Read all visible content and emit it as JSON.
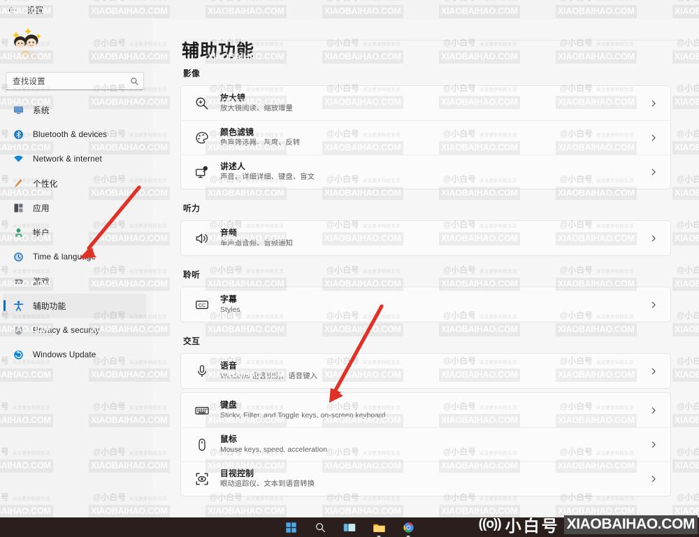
{
  "titlebar": {
    "back_icon": "back-arrow-icon",
    "title": "设置"
  },
  "sidebar": {
    "avatar": "user-avatar",
    "search": {
      "placeholder": "查找设置",
      "value": "查找设置",
      "icon": "search-icon"
    },
    "items": [
      {
        "label": "系统",
        "icon": "monitor-icon",
        "selected": false
      },
      {
        "label": "Bluetooth & devices",
        "icon": "bluetooth-icon",
        "selected": false
      },
      {
        "label": "Network & internet",
        "icon": "wifi-icon",
        "selected": false
      },
      {
        "label": "个性化",
        "icon": "brush-icon",
        "selected": false
      },
      {
        "label": "应用",
        "icon": "apps-icon",
        "selected": false
      },
      {
        "label": "帐户",
        "icon": "account-icon",
        "selected": false
      },
      {
        "label": "Time & language",
        "icon": "clock-icon",
        "selected": false
      },
      {
        "label": "游戏",
        "icon": "gamepad-icon",
        "selected": false
      },
      {
        "label": "辅助功能",
        "icon": "accessibility-icon",
        "selected": true
      },
      {
        "label": "Privacy & security",
        "icon": "shield-icon",
        "selected": false
      },
      {
        "label": "Windows Update",
        "icon": "update-icon",
        "selected": false
      }
    ]
  },
  "main": {
    "page_title": "辅助功能",
    "groups": [
      {
        "title": "影像",
        "cards": [
          {
            "rows": [
              {
                "title": "放大镜",
                "subtitle": "放大镜阅读、缩放增量",
                "icon": "magnifier-icon",
                "chevron": "chevron-right-icon"
              },
              {
                "title": "颜色滤镜",
                "subtitle": "色盲筛选器、灰度、反转",
                "icon": "color-palette-icon",
                "chevron": "chevron-right-icon"
              },
              {
                "title": "讲述人",
                "subtitle": "声音、详细详细、键盘、盲文",
                "icon": "narrator-icon",
                "chevron": "chevron-right-icon"
              }
            ]
          }
        ]
      },
      {
        "title": "听力",
        "cards": [
          {
            "rows": [
              {
                "title": "音频",
                "subtitle": "单声道音频、音频通知",
                "icon": "audio-icon",
                "chevron": "chevron-right-icon"
              }
            ]
          }
        ]
      },
      {
        "title": "聆听",
        "cards": [
          {
            "rows": [
              {
                "title": "字幕",
                "subtitle": "Styles",
                "icon": "closed-caption-icon",
                "chevron": "chevron-right-icon"
              }
            ]
          }
        ]
      },
      {
        "title": "交互",
        "cards": [
          {
            "rows": [
              {
                "title": "语音",
                "subtitle": "Windows 语音识别、语音键入",
                "icon": "microphone-icon",
                "chevron": "chevron-right-icon"
              }
            ]
          },
          {
            "rows": [
              {
                "title": "键盘",
                "subtitle": "Sticky, Filter, and Toggle keys, on-screen keyboard",
                "icon": "keyboard-icon",
                "chevron": "chevron-right-icon"
              },
              {
                "title": "鼠标",
                "subtitle": "Mouse keys, speed, acceleration",
                "icon": "mouse-icon",
                "chevron": "chevron-right-icon"
              },
              {
                "title": "目视控制",
                "subtitle": "眼动追踪仪、文本到语音转换",
                "icon": "eye-control-icon",
                "chevron": "chevron-right-icon"
              }
            ]
          }
        ]
      }
    ]
  },
  "taskbar": {
    "items": [
      {
        "icon": "windows-start-icon",
        "active": false
      },
      {
        "icon": "search-icon",
        "active": false
      },
      {
        "icon": "task-view-icon",
        "active": false
      },
      {
        "icon": "file-explorer-icon",
        "active": true
      },
      {
        "icon": "browser-icon",
        "active": true
      }
    ]
  },
  "branding": {
    "wave_icon": "signal-wave-icon",
    "name_cn": "小白号",
    "domain": "XIAOBAIHAO.COM"
  },
  "watermark": {
    "at_text": "@小白号",
    "sub_text": "关注更多科技生活",
    "domain_text": "XIAOBAIHAO.COM"
  },
  "annotations": {
    "arrow_color": "#e03127",
    "arrows": [
      {
        "name": "arrow-to-accessibility"
      },
      {
        "name": "arrow-to-keyboard"
      }
    ]
  }
}
